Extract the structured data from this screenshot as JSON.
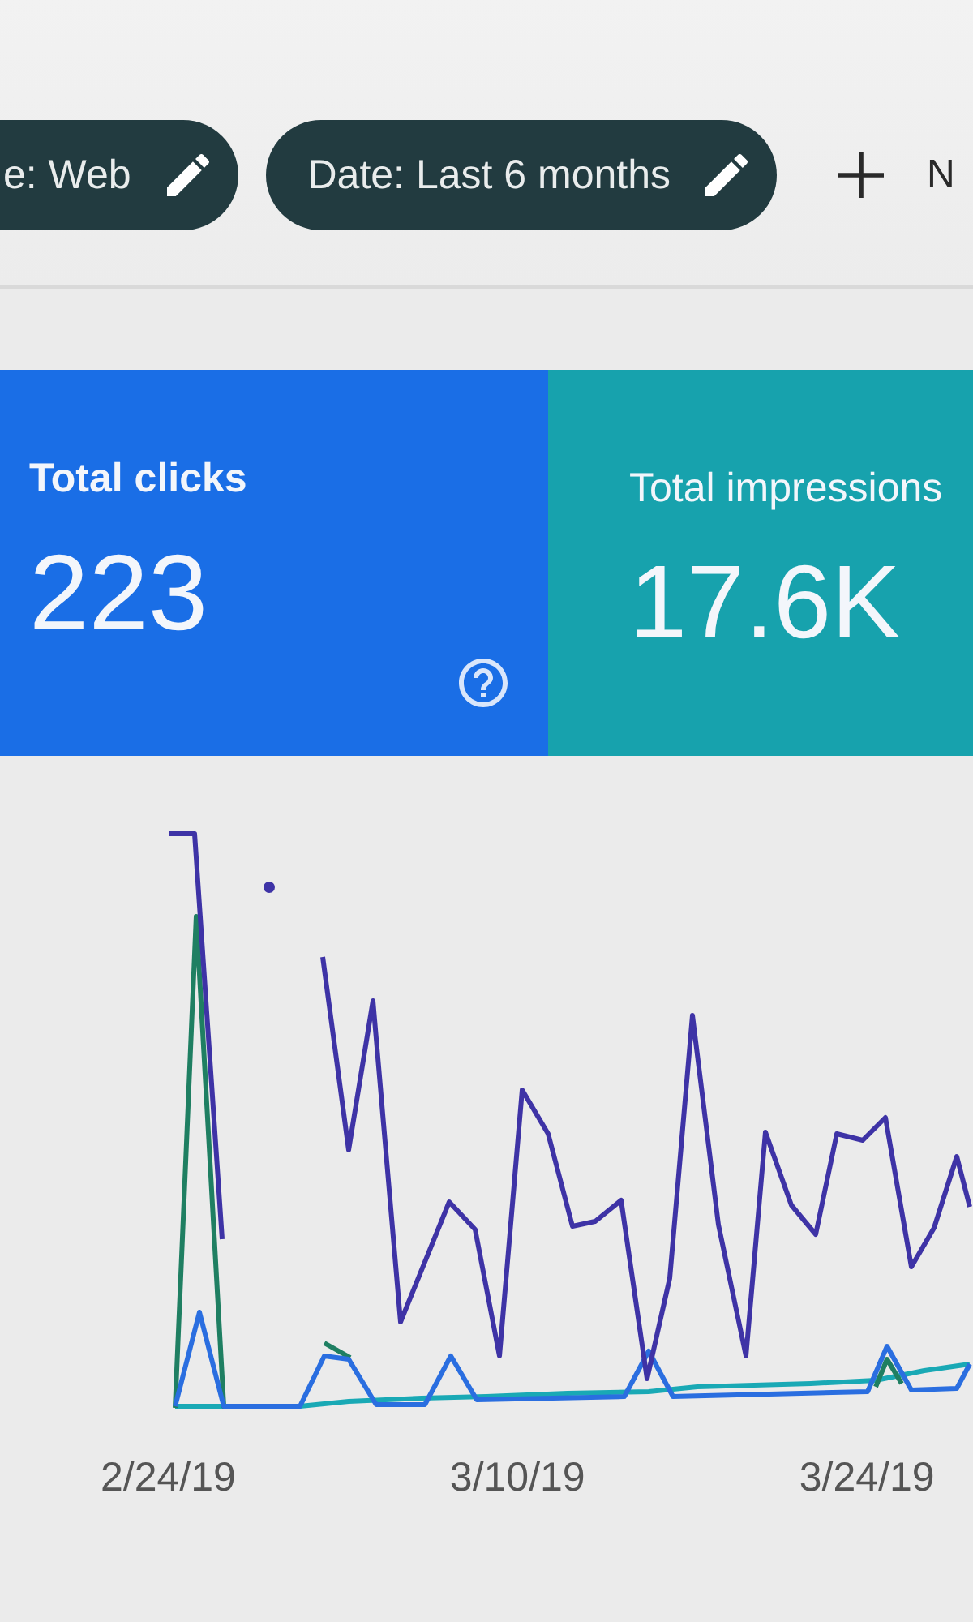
{
  "filters": [
    {
      "label": "e: Web"
    },
    {
      "label": "Date: Last 6 months"
    }
  ],
  "add_filter": {
    "label": "N"
  },
  "metrics": [
    {
      "label": "Total clicks",
      "value": "223",
      "selected": true,
      "color": "#1a6ee6",
      "help": true
    },
    {
      "label": "Total impressions",
      "value": "17.6K",
      "selected": true,
      "color": "#17a2ad",
      "help": false
    }
  ],
  "chart": {
    "dates": [
      "2/24/19",
      "3/10/19",
      "3/24/19"
    ]
  }
}
